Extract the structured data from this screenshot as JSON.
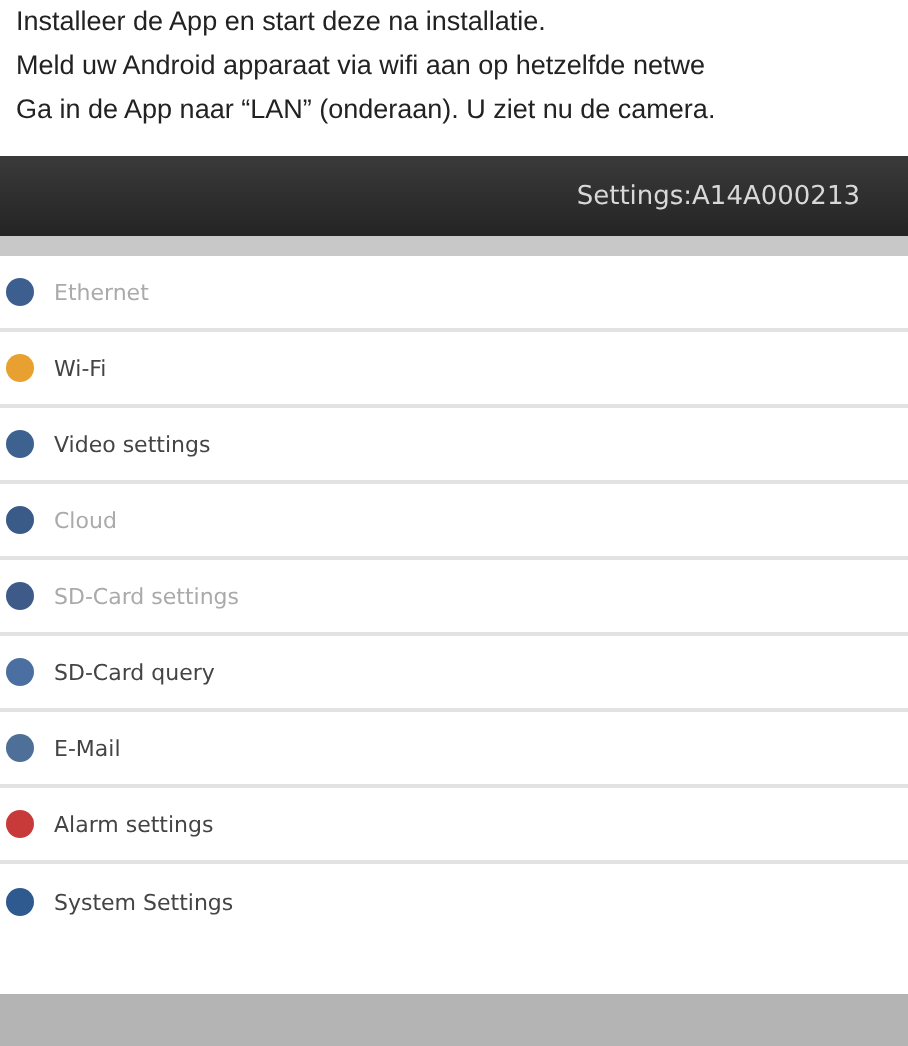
{
  "instructions": [
    "Installeer de App en start deze na installatie.",
    "Meld uw Android apparaat via wifi aan op hetzelfde netwe",
    "Ga in de App naar “LAN” (onderaan). U ziet nu de camera."
  ],
  "app": {
    "title": "Settings:A14A000213",
    "items": [
      {
        "label": "Ethernet",
        "disabled": true,
        "color": "#3d5f8f"
      },
      {
        "label": "Wi-Fi",
        "disabled": false,
        "color": "#e8a030"
      },
      {
        "label": "Video settings",
        "disabled": false,
        "color": "#3d6290"
      },
      {
        "label": "Cloud",
        "disabled": true,
        "color": "#3a5a88"
      },
      {
        "label": "SD-Card settings",
        "disabled": true,
        "color": "#3d5a88"
      },
      {
        "label": "SD-Card query",
        "disabled": false,
        "color": "#4a6fa0"
      },
      {
        "label": "E-Mail",
        "disabled": false,
        "color": "#4d6f98"
      },
      {
        "label": "Alarm settings",
        "disabled": false,
        "color": "#c83a3a"
      },
      {
        "label": "System Settings",
        "disabled": false,
        "color": "#2f5a90"
      }
    ]
  }
}
